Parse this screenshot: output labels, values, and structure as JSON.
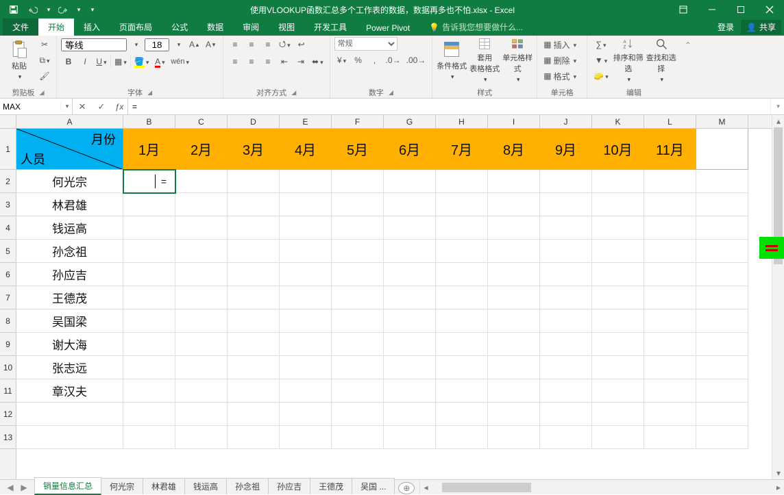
{
  "title": "使用VLOOKUP函数汇总多个工作表的数据，数据再多也不怕.xlsx - Excel",
  "tabs": {
    "file": "文件",
    "home": "开始",
    "insert": "插入",
    "layout": "页面布局",
    "formulas": "公式",
    "data": "数据",
    "review": "审阅",
    "view": "视图",
    "dev": "开发工具",
    "pivot": "Power Pivot",
    "tell": "告诉我您想要做什么...",
    "login": "登录",
    "share": "共享"
  },
  "ribbon": {
    "clipboard": {
      "label": "剪贴板",
      "paste": "粘贴"
    },
    "font": {
      "label": "字体",
      "name": "等线",
      "size": "18",
      "bold": "B",
      "italic": "I",
      "underline": "U"
    },
    "align": {
      "label": "对齐方式"
    },
    "number": {
      "label": "数字",
      "format": "常规"
    },
    "styles": {
      "label": "样式",
      "cond": "条件格式",
      "table": "套用\n表格格式",
      "cell": "单元格样式"
    },
    "cells": {
      "label": "单元格",
      "insert": "插入",
      "delete": "删除",
      "format": "格式"
    },
    "editing": {
      "label": "编辑",
      "sort": "排序和筛选",
      "find": "查找和选择"
    }
  },
  "namebox": "MAX",
  "formula": "=",
  "columns": [
    "A",
    "B",
    "C",
    "D",
    "E",
    "F",
    "G",
    "H",
    "I",
    "J",
    "K",
    "L",
    "M"
  ],
  "rows": [
    "1",
    "2",
    "3",
    "4",
    "5",
    "6",
    "7",
    "8",
    "9",
    "10",
    "11",
    "12",
    "13"
  ],
  "header_cell": {
    "bottom_left": "人员",
    "top_right": "月份"
  },
  "months": [
    "1月",
    "2月",
    "3月",
    "4月",
    "5月",
    "6月",
    "7月",
    "8月",
    "9月",
    "10月",
    "11月"
  ],
  "people": [
    "何光宗",
    "林君雄",
    "钱运高",
    "孙念祖",
    "孙应吉",
    "王德茂",
    "吴国梁",
    "谢大海",
    "张志远",
    "章汉夫"
  ],
  "active_cell_text": "=",
  "sheet_tabs": [
    "销量信息汇总",
    "何光宗",
    "林君雄",
    "钱运高",
    "孙念祖",
    "孙应吉",
    "王德茂",
    "吴国 ..."
  ],
  "chart_data": {
    "type": "table",
    "row_headers_field": "人员",
    "column_headers_field": "月份",
    "columns": [
      "1月",
      "2月",
      "3月",
      "4月",
      "5月",
      "6月",
      "7月",
      "8月",
      "9月",
      "10月",
      "11月"
    ],
    "rows": [
      "何光宗",
      "林君雄",
      "钱运高",
      "孙念祖",
      "孙应吉",
      "王德茂",
      "吴国梁",
      "谢大海",
      "张志远",
      "章汉夫"
    ],
    "values": [
      [
        null,
        null,
        null,
        null,
        null,
        null,
        null,
        null,
        null,
        null,
        null
      ],
      [
        null,
        null,
        null,
        null,
        null,
        null,
        null,
        null,
        null,
        null,
        null
      ],
      [
        null,
        null,
        null,
        null,
        null,
        null,
        null,
        null,
        null,
        null,
        null
      ],
      [
        null,
        null,
        null,
        null,
        null,
        null,
        null,
        null,
        null,
        null,
        null
      ],
      [
        null,
        null,
        null,
        null,
        null,
        null,
        null,
        null,
        null,
        null,
        null
      ],
      [
        null,
        null,
        null,
        null,
        null,
        null,
        null,
        null,
        null,
        null,
        null
      ],
      [
        null,
        null,
        null,
        null,
        null,
        null,
        null,
        null,
        null,
        null,
        null
      ],
      [
        null,
        null,
        null,
        null,
        null,
        null,
        null,
        null,
        null,
        null,
        null
      ],
      [
        null,
        null,
        null,
        null,
        null,
        null,
        null,
        null,
        null,
        null,
        null
      ],
      [
        null,
        null,
        null,
        null,
        null,
        null,
        null,
        null,
        null,
        null,
        null
      ]
    ]
  }
}
